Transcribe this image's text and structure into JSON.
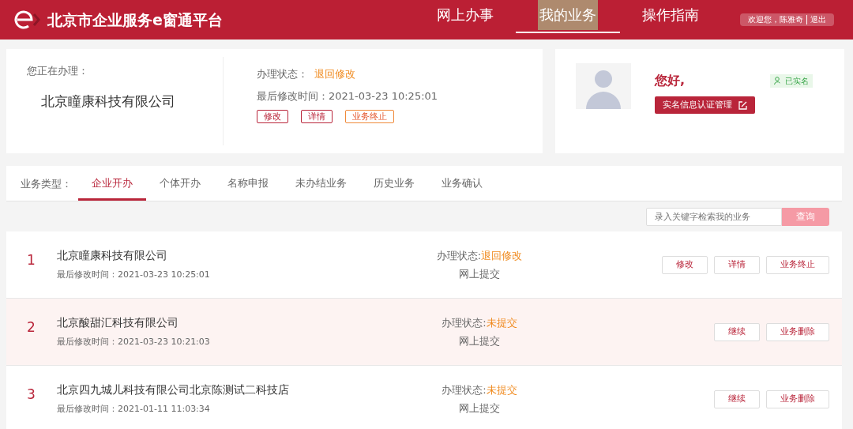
{
  "header": {
    "title": "北京市企业服务e窗通平台",
    "nav": [
      {
        "label": "网上办事",
        "selected": false
      },
      {
        "label": "我的业务",
        "selected": true
      },
      {
        "label": "操作指南",
        "selected": false
      }
    ],
    "welcome": "欢迎您，陈雅奇",
    "logout": "退出"
  },
  "current": {
    "label": "您正在办理：",
    "company": "北京瞳康科技有限公司",
    "status_label": "办理状态：",
    "status": "退回修改",
    "time_label": "最后修改时间：",
    "time": "2021-03-23 10:25:01",
    "buttons": [
      {
        "label": "修改",
        "kind": "red"
      },
      {
        "label": "详情",
        "kind": "red"
      },
      {
        "label": "业务终止",
        "kind": "orange"
      }
    ]
  },
  "user": {
    "greeting": "您好,",
    "verified": "已实名",
    "manage_button": "实名信息认证管理"
  },
  "tabs_label": "业务类型：",
  "tabs": [
    {
      "label": "企业开办",
      "selected": true
    },
    {
      "label": "个体开办",
      "selected": false
    },
    {
      "label": "名称申报",
      "selected": false
    },
    {
      "label": "未办结业务",
      "selected": false
    },
    {
      "label": "历史业务",
      "selected": false
    },
    {
      "label": "业务确认",
      "selected": false
    }
  ],
  "search": {
    "placeholder": "录入关键字检索我的业务",
    "button": "查询"
  },
  "rows": [
    {
      "index": "1",
      "company": "北京瞳康科技有限公司",
      "time": "最后修改时间：2021-03-23 10:25:01",
      "status_label": "办理状态:",
      "status": "退回修改",
      "channel": "网上提交",
      "selected": false,
      "buttons": [
        "修改",
        "详情",
        "业务终止"
      ]
    },
    {
      "index": "2",
      "company": "北京酸甜汇科技有限公司",
      "time": "最后修改时间：2021-03-23 10:21:03",
      "status_label": "办理状态:",
      "status": "未提交",
      "channel": "网上提交",
      "selected": true,
      "buttons": [
        "继续",
        "业务删除"
      ]
    },
    {
      "index": "3",
      "company": "北京四九城儿科技有限公司北京陈测试二科技店",
      "time": "最后修改时间：2021-01-11 11:03:34",
      "status_label": "办理状态:",
      "status": "未提交",
      "channel": "网上提交",
      "selected": false,
      "buttons": [
        "继续",
        "业务删除"
      ]
    }
  ]
}
